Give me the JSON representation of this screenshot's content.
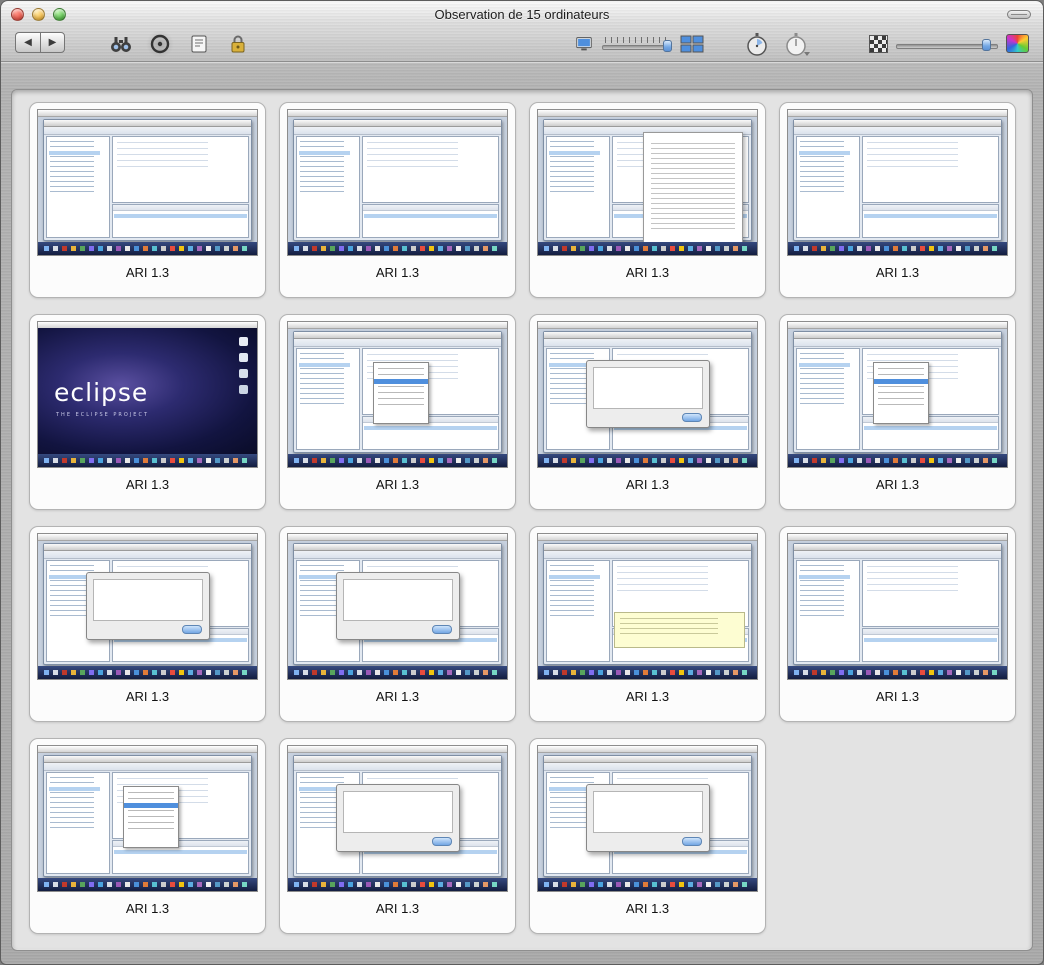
{
  "window": {
    "title": "Observation de 15 ordinateurs"
  },
  "toolbar": {
    "back_glyph": "◀",
    "forward_glyph": "▶",
    "icons": [
      "binoculars-icon",
      "observe-target-icon",
      "note-icon",
      "lock-icon",
      "display-icon",
      "screens-grid-icon",
      "stopwatch-icon",
      "stopwatch-menu-icon",
      "checkerboard-icon",
      "color-palette-icon"
    ]
  },
  "splash": {
    "logo": "eclipse",
    "subtitle": "THE ECLIPSE PROJECT"
  },
  "colors": {
    "dock_navy": "#16224a",
    "aqua_blue": "#4f8fdd",
    "metal_gray": "#bcbcbc"
  },
  "computers": [
    {
      "label": "ARI 1.3",
      "variant": "ide"
    },
    {
      "label": "ARI 1.3",
      "variant": "ide"
    },
    {
      "label": "ARI 1.3",
      "variant": "doc"
    },
    {
      "label": "ARI 1.3",
      "variant": "ide"
    },
    {
      "label": "ARI 1.3",
      "variant": "splash"
    },
    {
      "label": "ARI 1.3",
      "variant": "menu"
    },
    {
      "label": "ARI 1.3",
      "variant": "dialog"
    },
    {
      "label": "ARI 1.3",
      "variant": "menu"
    },
    {
      "label": "ARI 1.3",
      "variant": "dialog"
    },
    {
      "label": "ARI 1.3",
      "variant": "dialog"
    },
    {
      "label": "ARI 1.3",
      "variant": "code"
    },
    {
      "label": "ARI 1.3",
      "variant": "ide"
    },
    {
      "label": "ARI 1.3",
      "variant": "menu"
    },
    {
      "label": "ARI 1.3",
      "variant": "dialog"
    },
    {
      "label": "ARI 1.3",
      "variant": "dialog"
    }
  ]
}
